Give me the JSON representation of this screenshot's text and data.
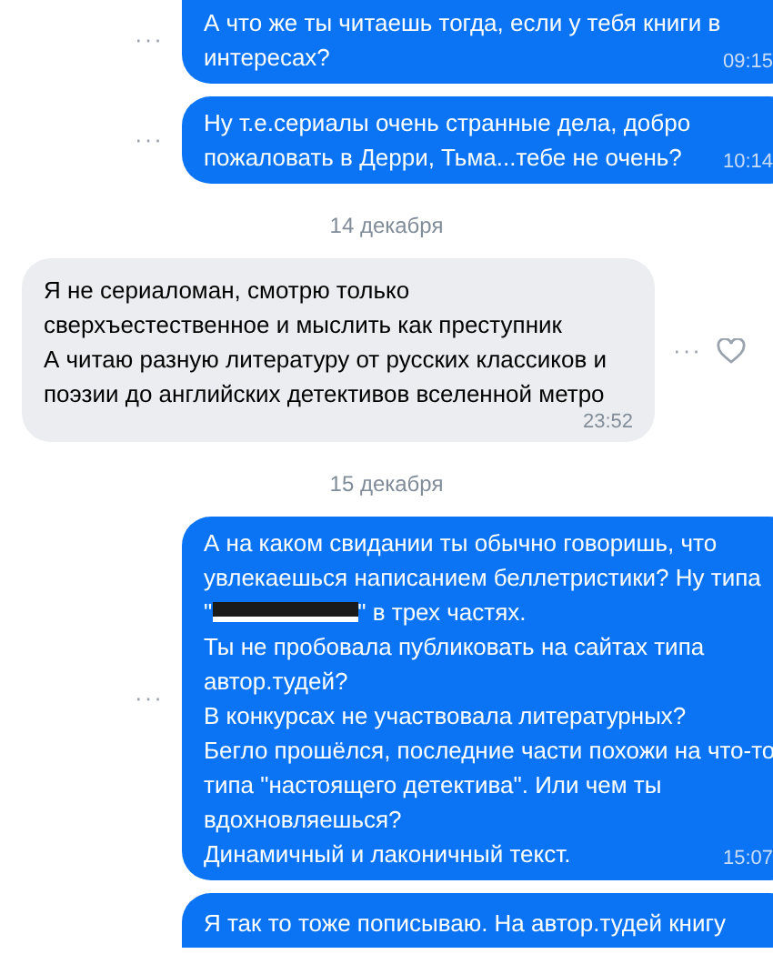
{
  "messages": [
    {
      "kind": "message",
      "outgoing": true,
      "more": "···",
      "lines": [
        {
          "kind": "text",
          "text": "А что же ты читаешь тогда, если у тебя книги в интересах?"
        }
      ],
      "time": "09:15",
      "cut_top": true
    },
    {
      "kind": "message",
      "outgoing": true,
      "more": "···",
      "lines": [
        {
          "kind": "text",
          "text": "Ну т.е.сериалы очень странные дела, добро пожаловать в Дерри, Тьма...тебе не очень?"
        }
      ],
      "time": "10:14"
    },
    {
      "kind": "date",
      "text": "14 декабря"
    },
    {
      "kind": "message",
      "outgoing": false,
      "more": "···",
      "lines": [
        {
          "kind": "text",
          "text": "Я не сериаломан, смотрю только сверхъестественное и мыслить как преступник"
        },
        {
          "kind": "text",
          "text": "А читаю разную литературу от русских классиков и поэзии до английских детективов вселенной метро"
        }
      ],
      "time": "23:52"
    },
    {
      "kind": "date",
      "text": "15 декабря"
    },
    {
      "kind": "message",
      "outgoing": true,
      "more": "···",
      "lines": [
        {
          "kind": "text",
          "text": "А на каком свидании ты обычно говоришь, что увлекаешься написанием беллетристики? Ну типа"
        },
        {
          "kind": "redacted",
          "before": "\"",
          "after": "\" в трех частях."
        },
        {
          "kind": "text",
          "text": "Ты не пробовала публиковать на сайтах типа автор.тудей?"
        },
        {
          "kind": "text",
          "text": "В конкурсах не участвовала литературных?"
        },
        {
          "kind": "text",
          "text": "Бегло прошёлся, последние части похожи на что-то типа \"настоящего детектива\". Или чем ты вдохновляешься?"
        },
        {
          "kind": "text",
          "text": "Динамичный и лаконичный текст."
        }
      ],
      "time": "15:07"
    },
    {
      "kind": "message",
      "outgoing": true,
      "lines": [
        {
          "kind": "text",
          "text": "Я так то тоже пописываю. На автор.тудей книгу"
        }
      ],
      "cut_bottom": true
    }
  ]
}
